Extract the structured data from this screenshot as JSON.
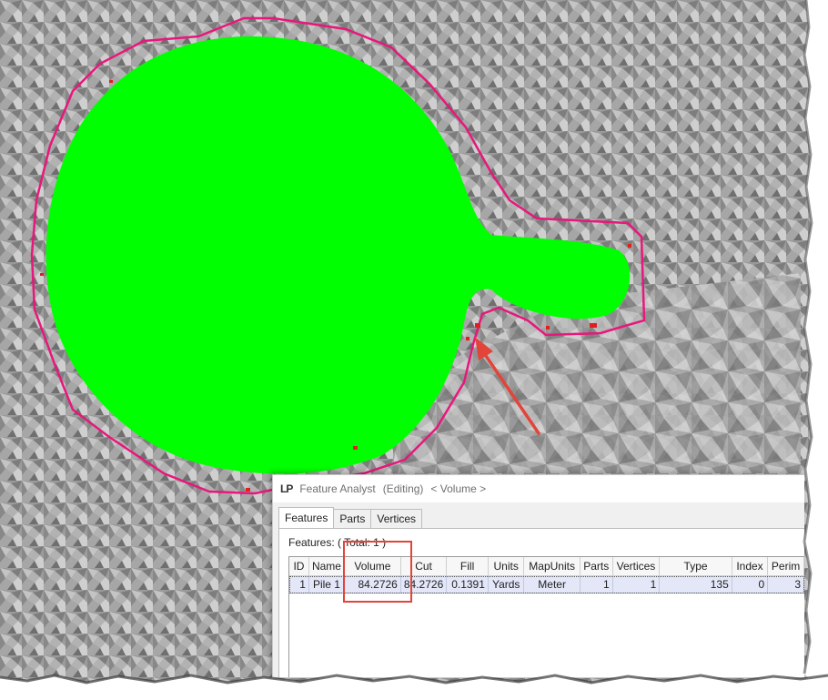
{
  "window": {
    "logo": "LP",
    "title": "Feature Analyst",
    "mode": "(Editing)",
    "layer": "< Volume >"
  },
  "tabs": [
    "Features",
    "Parts",
    "Vertices"
  ],
  "features_label": "Features: ( Total: 1 )",
  "table": {
    "columns": [
      "ID",
      "Name",
      "Volume",
      "Cut",
      "Fill",
      "Units",
      "MapUnits",
      "Parts",
      "Vertices",
      "Type",
      "Index",
      "Perim"
    ],
    "rows": [
      [
        "1",
        "Pile 1",
        "84.2726",
        "84.2726",
        "0.1391",
        "Yards",
        "Meter",
        "1",
        "1",
        "135",
        "0",
        "3"
      ]
    ]
  },
  "colors": {
    "pile_fill": "#00ff00",
    "boundary": "#e8177c",
    "annotation": "#e3443a",
    "terrain": "#9a9a9a"
  }
}
